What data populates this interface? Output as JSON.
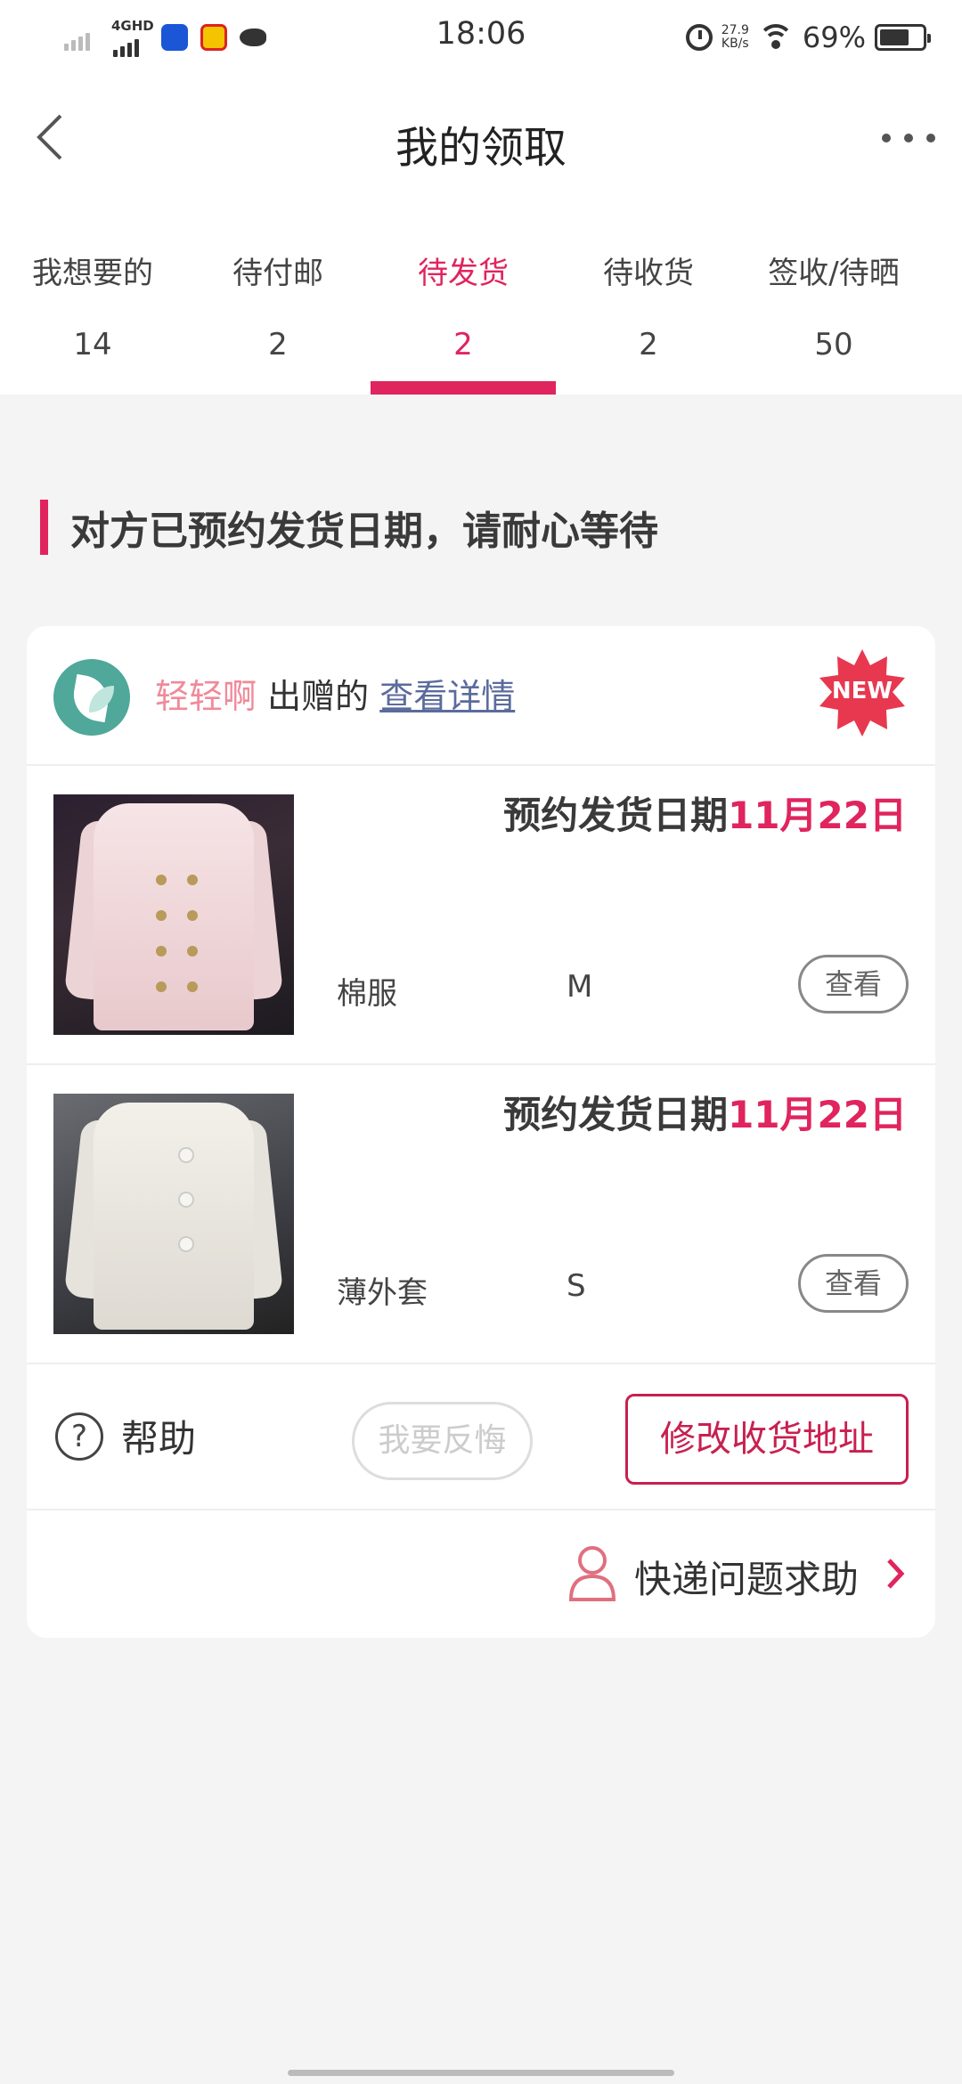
{
  "status": {
    "network": "4GHD",
    "time": "18:06",
    "speed_top": "27.9",
    "speed_unit": "KB/s",
    "battery": "69%",
    "battery_level": 0.69
  },
  "header": {
    "title": "我的领取"
  },
  "tabs": [
    {
      "label": "我想要的",
      "count": "14"
    },
    {
      "label": "待付邮",
      "count": "2"
    },
    {
      "label": "待发货",
      "count": "2"
    },
    {
      "label": "待收货",
      "count": "2"
    },
    {
      "label": "签收/待晒",
      "count": "50"
    }
  ],
  "active_tab": "待发货",
  "notice": "对方已预约发货日期，请耐心等待",
  "order": {
    "giver_name": "轻轻啊",
    "giver_suffix": "出赠的",
    "detail_link": "查看详情",
    "badge": "NEW",
    "items": [
      {
        "date_label": "预约发货日期",
        "date": "11月22日",
        "name": "棉服",
        "size": "M",
        "view": "查看"
      },
      {
        "date_label": "预约发货日期",
        "date": "11月22日",
        "name": "薄外套",
        "size": "S",
        "view": "查看"
      }
    ],
    "help_icon": "?",
    "help": "帮助",
    "regret": "我要反悔",
    "change_address": "修改收货地址",
    "express_help": "快递问题求助"
  },
  "colors": {
    "accent": "#e0245e",
    "giver": "#f08a9a",
    "link": "#5b6b9c"
  }
}
